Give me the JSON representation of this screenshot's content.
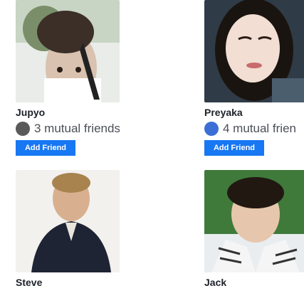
{
  "suggestions": [
    {
      "name": "Jupyo",
      "mutual_text": "3 mutual friends",
      "button_label": "Add Friend",
      "avatar_color": "#5a5a5a"
    },
    {
      "name": "Preyaka",
      "mutual_text": "4 mutual frien",
      "button_label": "Add Friend",
      "avatar_color": "#3b6fd6"
    },
    {
      "name": "Steve"
    },
    {
      "name": "Jack"
    }
  ],
  "colors": {
    "accent": "#1877f2",
    "name_text": "#1d2129",
    "secondary_text": "#4b4f56"
  }
}
